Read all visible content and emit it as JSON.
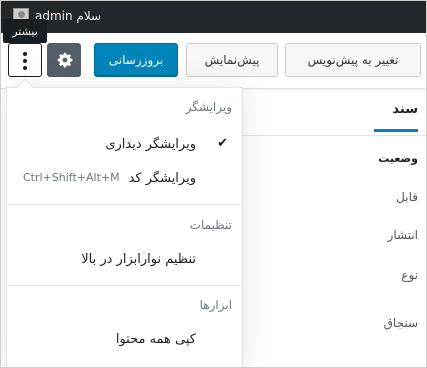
{
  "admin_bar": {
    "greeting": "سلام admin"
  },
  "toolbar": {
    "switch_label": "تغییر به پیش‌نویس",
    "preview_label": "پیش‌نمایش",
    "update_label": "بروزرسانی",
    "settings_icon": "gear-icon",
    "more_icon": "more-vertical-icon",
    "more_tooltip": "بیشتر"
  },
  "sidebar": {
    "tab_document": "سند",
    "rows": [
      "وضعیت",
      "قابل",
      "انتشار",
      "نوع",
      "سنجاق"
    ]
  },
  "menu": {
    "groups": [
      {
        "label": "ویرایشگر",
        "items": [
          {
            "label": "ویرایشگر دیداری",
            "checked": true,
            "shortcut": ""
          },
          {
            "label": "ویرایشگر کد",
            "checked": false,
            "shortcut": "Ctrl+Shift+Alt+M"
          }
        ]
      },
      {
        "label": "تنظیمات",
        "items": [
          {
            "label": "تنظیم نوارابزار در بالا",
            "checked": false,
            "shortcut": ""
          }
        ]
      },
      {
        "label": "ابزارها",
        "items": [
          {
            "label": "کپی همه محتوا",
            "checked": false,
            "shortcut": ""
          }
        ]
      }
    ],
    "check_glyph": "✔"
  },
  "colors": {
    "admin_bar": "#23282d",
    "primary": "#0085ba",
    "gear_bg": "#555d66"
  }
}
